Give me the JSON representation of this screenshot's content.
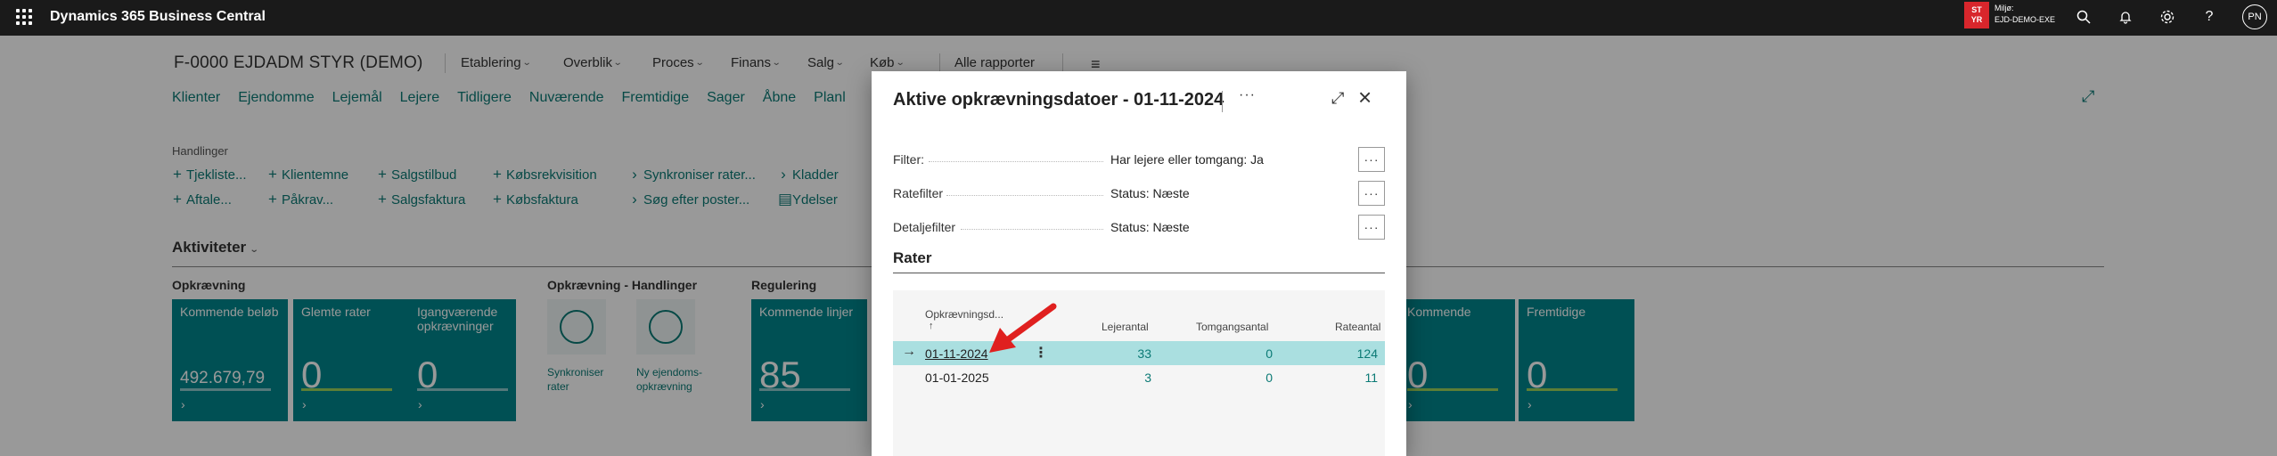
{
  "app": {
    "title": "Dynamics 365 Business Central"
  },
  "environment": {
    "badge": "ST\nYR",
    "badge_line1": "ST",
    "badge_line2": "YR",
    "label": "Miljø:",
    "name": "EJD-DEMO-EXE",
    "color": "#d8262c"
  },
  "user": {
    "initials": "PN"
  },
  "topbar_icons": [
    "search-icon",
    "bell-icon",
    "gear-icon",
    "help-icon"
  ],
  "company": {
    "title": "F-0000 EJDADM STYR (DEMO)"
  },
  "main_menu": [
    {
      "label": "Etablering"
    },
    {
      "label": "Overblik"
    },
    {
      "label": "Proces"
    },
    {
      "label": "Finans"
    },
    {
      "label": "Salg"
    },
    {
      "label": "Køb"
    },
    {
      "label": "Alle rapporter"
    }
  ],
  "sub_nav": [
    "Klienter",
    "Ejendomme",
    "Lejemål",
    "Lejere",
    "Tidligere",
    "Nuværende",
    "Fremtidige",
    "Sager",
    "Åbne",
    "Planl"
  ],
  "actions": {
    "label": "Handlinger",
    "items": [
      "Tjekliste...",
      "Aftale...",
      "Klientemne",
      "Påkrav...",
      "Salgstilbud",
      "Salgsfaktura",
      "Købsrekvisition",
      "Købsfaktura",
      "Synkroniser rater...",
      "Søg efter poster...",
      "Kladder",
      "Ydelser"
    ]
  },
  "activities": {
    "title": "Aktiviteter",
    "groups": {
      "opkraevning": "Opkrævning",
      "handlinger": "Opkrævning - Handlinger",
      "regulering": "Regulering"
    },
    "tiles": [
      {
        "label": "Kommende beløb",
        "value": "492.679,79"
      },
      {
        "label": "Glemte rater",
        "value": "0"
      },
      {
        "label": "Igangværende opkrævninger",
        "value": "0"
      },
      {
        "label": "Kommende linjer",
        "value": "85"
      },
      {
        "label": "Kommende",
        "value": "0"
      },
      {
        "label": "Fremtidige",
        "value": "0"
      }
    ],
    "action_tiles": [
      {
        "label": "Synkroniser rater"
      },
      {
        "label": "Ny ejendoms-opkrævning"
      }
    ]
  },
  "dialog": {
    "title": "Aktive opkrævningsdatoer - 01-11-2024",
    "more": "···",
    "filters": [
      {
        "label": "Filter:",
        "value": "Har lejere eller tomgang: Ja"
      },
      {
        "label": "Ratefilter",
        "value": "Status: Næste"
      },
      {
        "label": "Detaljefilter",
        "value": "Status: Næste"
      }
    ],
    "section": "Rater",
    "columns": [
      "Opkrævningsd...",
      "Lejerantal",
      "Tomgangsantal",
      "Rateantal"
    ],
    "rows": [
      {
        "date": "01-11-2024",
        "lejere": "33",
        "tomgang": "0",
        "rater": "124",
        "selected": true
      },
      {
        "date": "01-01-2025",
        "lejere": "3",
        "tomgang": "0",
        "rater": "11",
        "selected": false
      }
    ]
  },
  "colors": {
    "accent": "#0b7a75",
    "tile": "#00868c",
    "selected_row": "#aadfe0",
    "annotation_arrow": "#e0201f"
  }
}
